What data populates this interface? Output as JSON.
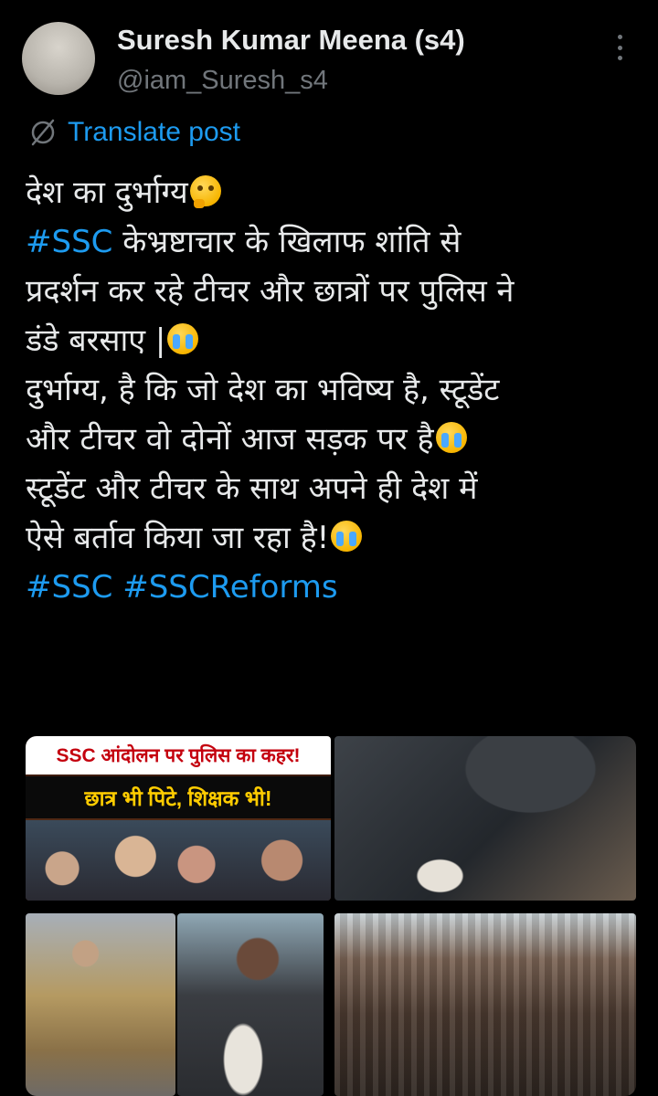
{
  "author": {
    "display_name": "Suresh Kumar Meena (s4)",
    "handle": "@iam_Suresh_s4",
    "avatar_icon": "profile-photo-icon"
  },
  "header": {
    "more_icon": "more-vertical-icon"
  },
  "translate": {
    "label": "Translate post",
    "icon": "translate-icon",
    "color": "#1d9bf0"
  },
  "post": {
    "lines": [
      {
        "text": "देश का दुर्भाग्य"
      },
      {
        "hashtag": "#SSC",
        "text": " केभ्रष्टाचार के खिलाफ शांति से"
      },
      {
        "text": "प्रदर्शन कर रहे टीचर और छात्रों पर पुलिस ने"
      },
      {
        "text": "डंडे बरसाए |"
      },
      {
        "text": "दुर्भाग्य, है कि जो देश का भविष्य है, स्टूडेंट"
      },
      {
        "text": "और टीचर वो दोनों आज सड़क पर है"
      },
      {
        "text": "स्टूडेंट और टीचर के साथ अपने ही देश में"
      },
      {
        "text": "ऐसे बर्ताव किया जा रहा है!"
      }
    ],
    "hashtags": [
      "#SSC",
      "#SSCReforms"
    ],
    "emoji": {
      "thinking": "thinking-face-icon",
      "crying": "loudly-crying-face-icon"
    },
    "link_color": "#1d9bf0"
  },
  "media": {
    "banner_headline_1": "SSC आंदोलन पर पुलिस का कहर!",
    "banner_headline_2": "छात्र भी पिटे, शिक्षक भी!"
  }
}
